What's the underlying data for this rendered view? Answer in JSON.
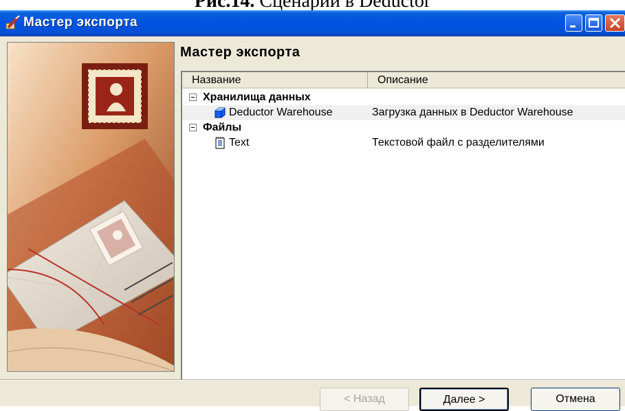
{
  "caption": {
    "bold": "Рис.14.",
    "text": " Сценарий в Deductor"
  },
  "window": {
    "title": "Мастер экспорта"
  },
  "page": {
    "heading": "Мастер экспорта"
  },
  "list": {
    "columns": {
      "name": "Название",
      "description": "Описание"
    },
    "groups": [
      {
        "label": "Хранилища данных",
        "items": [
          {
            "name": "Deductor Warehouse",
            "description": "Загрузка данных в Deductor Warehouse",
            "icon": "cube-icon",
            "selected": true
          }
        ]
      },
      {
        "label": "Файлы",
        "items": [
          {
            "name": "Text",
            "description": "Текстовой файл с разделителями",
            "icon": "text-file-icon",
            "selected": false
          }
        ]
      }
    ]
  },
  "buttons": {
    "back": "< Назад",
    "next": "Далее >",
    "cancel": "Отмена"
  },
  "colors": {
    "titlebar": "#0054e3",
    "dialog_bg": "#ece9d8",
    "close": "#c74524"
  }
}
